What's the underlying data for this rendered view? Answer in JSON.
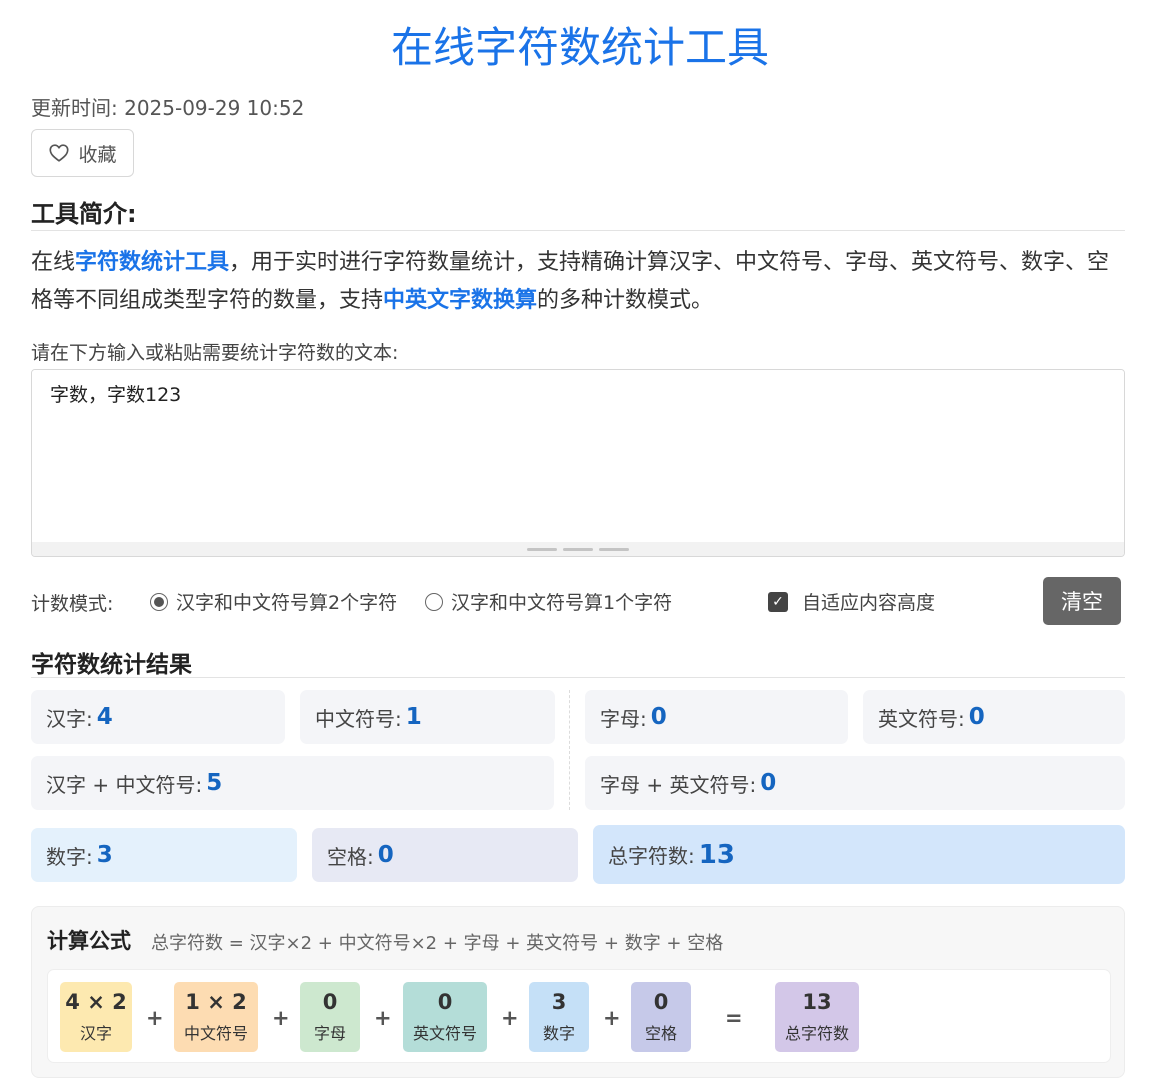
{
  "title": "在线字符数统计工具",
  "update_time": "更新时间: 2025-09-29 10:52",
  "favorite_label": "收藏",
  "intro": {
    "heading": "工具简介:",
    "p1": "在线",
    "link1": "字符数统计工具",
    "p2": "，用于实时进行字符数量统计，支持精确计算汉字、中文符号、字母、英文符号、数字、空格等不同组成类型字符的数量，支持",
    "link2": "中英文字数换算",
    "p3": "的多种计数模式。"
  },
  "input": {
    "prompt": "请在下方输入或粘贴需要统计字符数的文本:",
    "value": "字数，字数123"
  },
  "mode": {
    "label": "计数模式:",
    "option1": "汉字和中文符号算2个字符",
    "option2": "汉字和中文符号算1个字符",
    "selected": 1,
    "auto_height_label": "自适应内容高度",
    "auto_height_checked": true,
    "clear_label": "清空"
  },
  "results": {
    "heading": "字符数统计结果",
    "chinese_label": "汉字:",
    "chinese": "4",
    "cn_punct_label": "中文符号:",
    "cn_punct": "1",
    "letters_label": "字母:",
    "letters": "0",
    "en_punct_label": "英文符号:",
    "en_punct": "0",
    "cn_sum_label": "汉字 + 中文符号:",
    "cn_sum": "5",
    "en_sum_label": "字母 + 英文符号:",
    "en_sum": "0",
    "digits_label": "数字:",
    "digits": "3",
    "spaces_label": "空格:",
    "spaces": "0",
    "total_label": "总字符数:",
    "total": "13"
  },
  "formula": {
    "title": "计算公式",
    "desc": "总字符数 = 汉字×2 + 中文符号×2 + 字母 + 英文符号 + 数字 + 空格",
    "terms": [
      {
        "value": "4 × 2",
        "label": "汉字",
        "color": "#fde9b0"
      },
      {
        "value": "1 × 2",
        "label": "中文符号",
        "color": "#fddcb2"
      },
      {
        "value": "0",
        "label": "字母",
        "color": "#cde8cf"
      },
      {
        "value": "0",
        "label": "英文符号",
        "color": "#b4ddd8"
      },
      {
        "value": "3",
        "label": "数字",
        "color": "#c5e0f7"
      },
      {
        "value": "0",
        "label": "空格",
        "color": "#c6c9e9"
      }
    ],
    "plus": "+",
    "equals": "=",
    "result": {
      "value": "13",
      "label": "总字符数",
      "color": "#d3c7e8"
    }
  }
}
